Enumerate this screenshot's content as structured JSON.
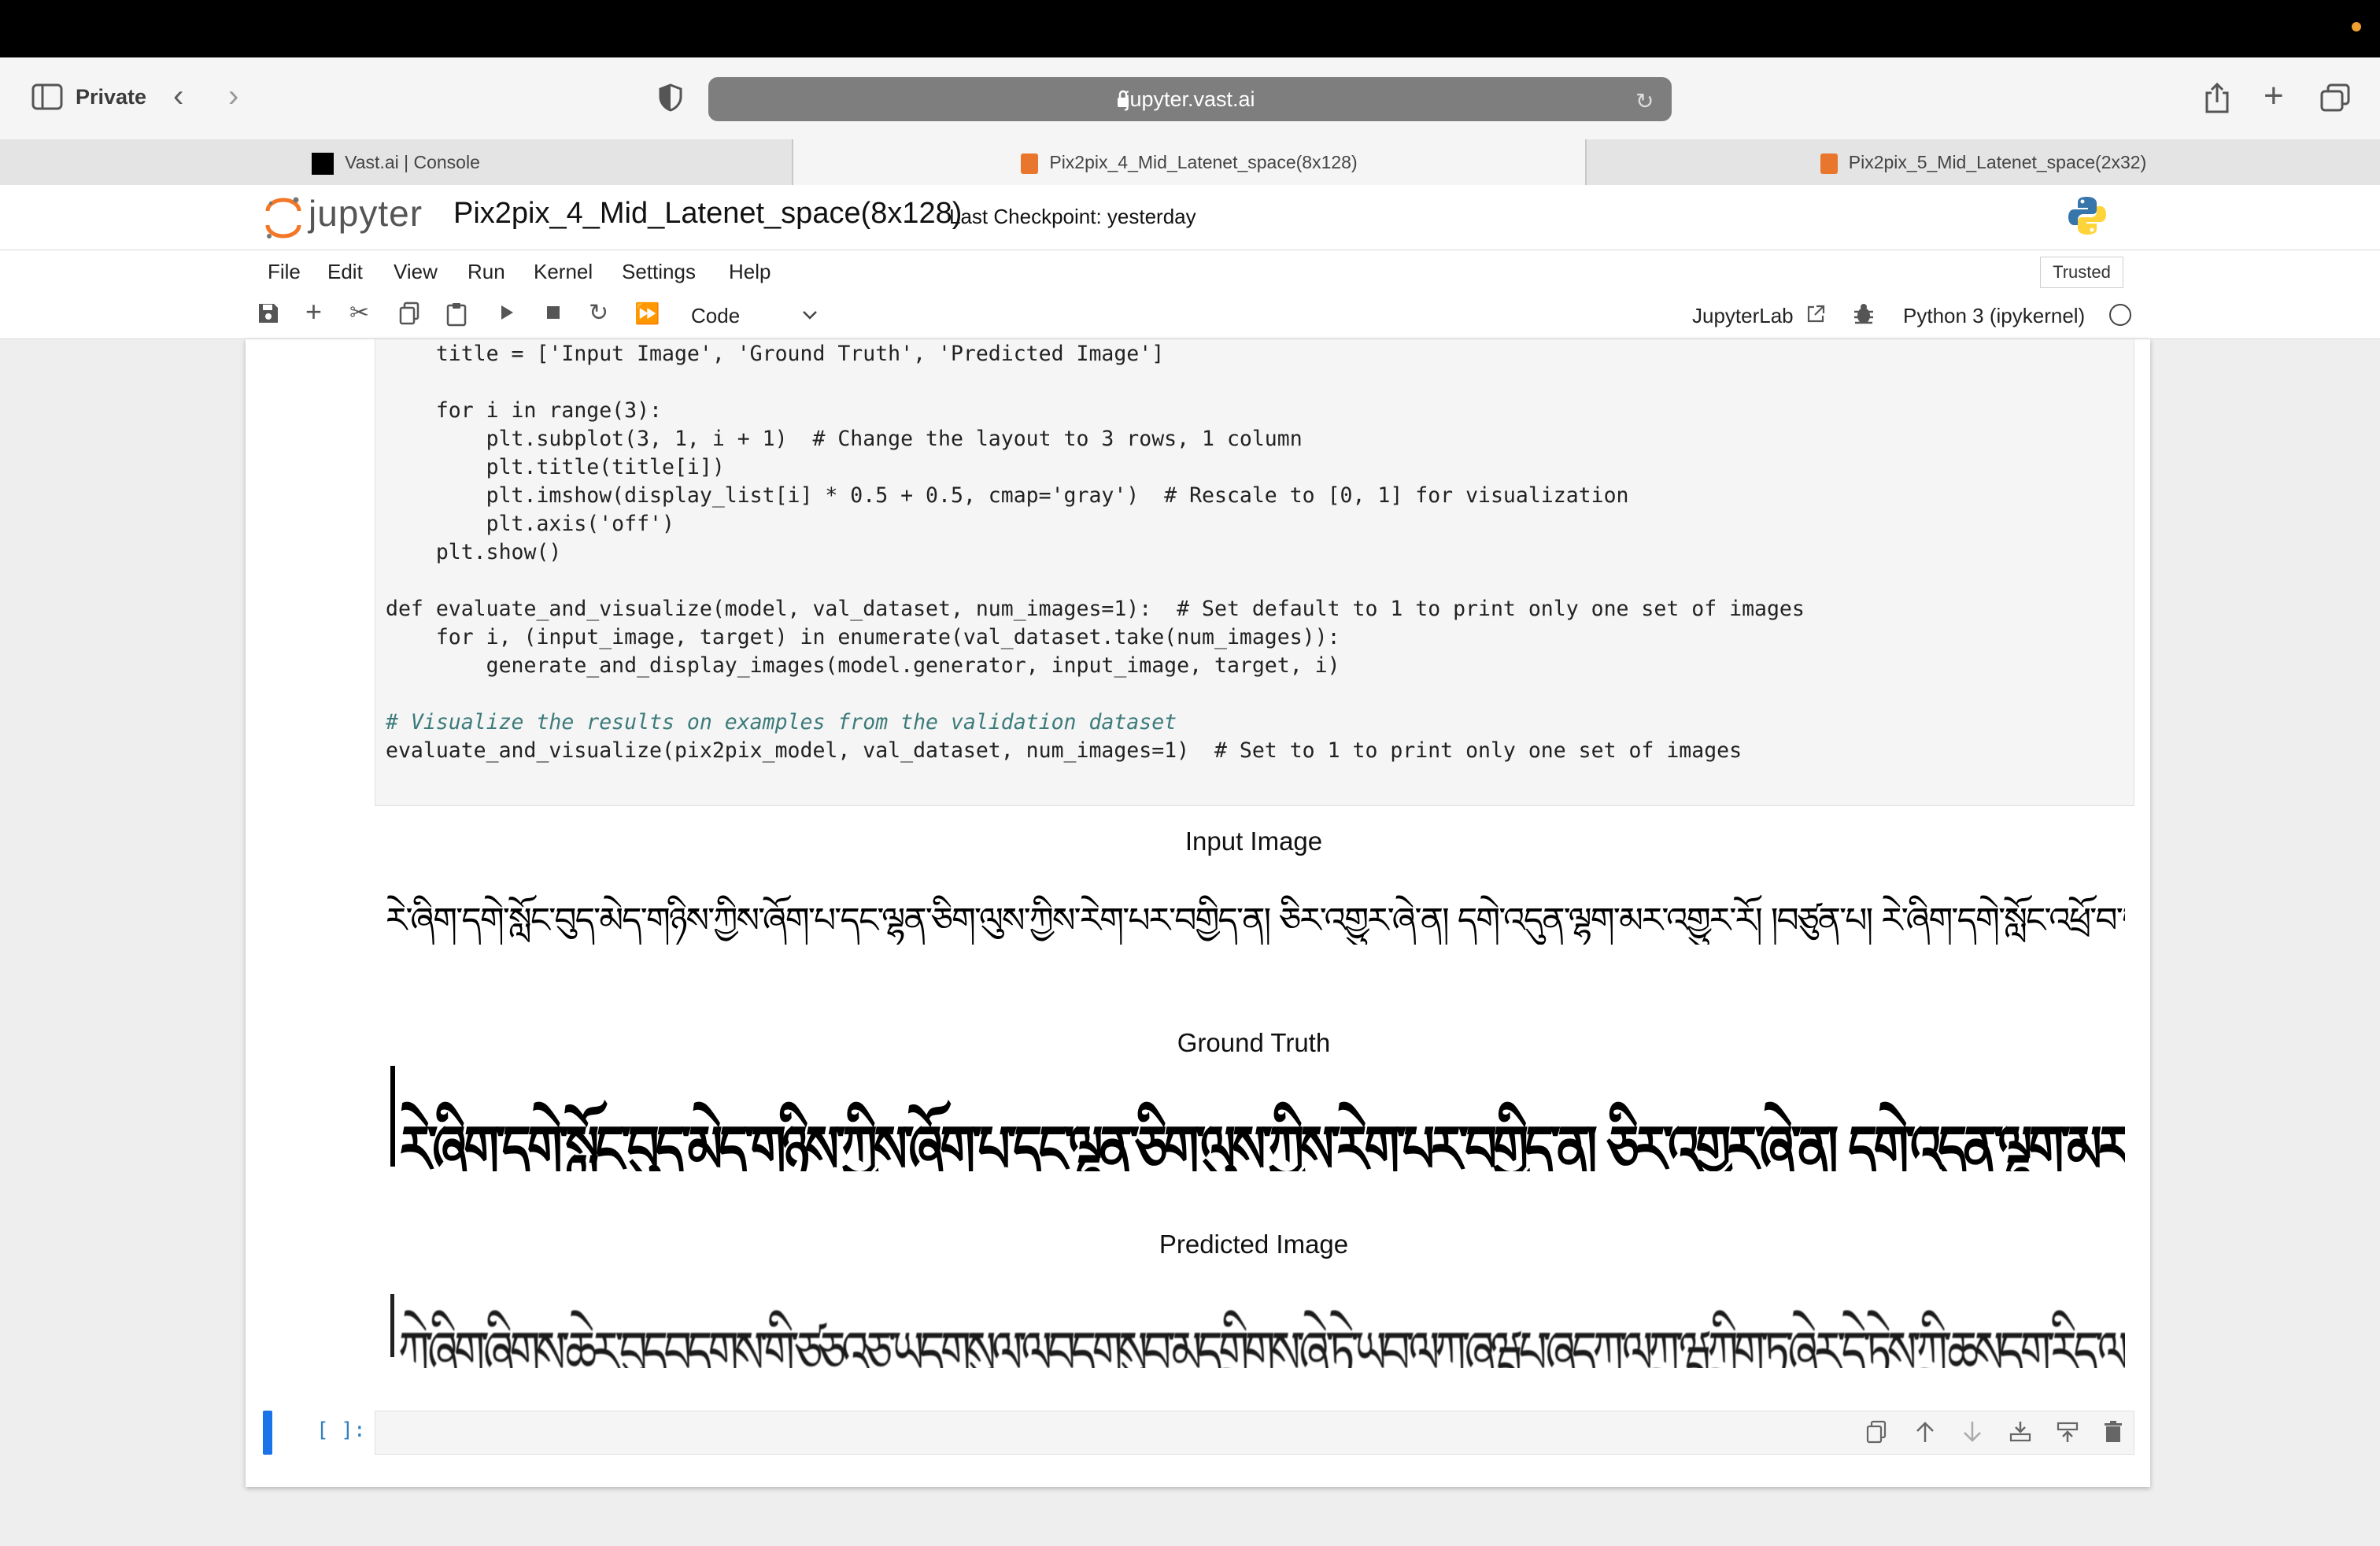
{
  "browser": {
    "private_label": "Private",
    "url": "jupyter.vast.ai",
    "tabs": [
      {
        "label": "Vast.ai | Console",
        "active": false
      },
      {
        "label": "Pix2pix_4_Mid_Latenet_space(8x128)",
        "active": true
      },
      {
        "label": "Pix2pix_5_Mid_Latenet_space(2x32)",
        "active": false
      }
    ]
  },
  "jupyter": {
    "logo_text": "jupyter",
    "notebook_title": "Pix2pix_4_Mid_Latenet_space(8x128)",
    "checkpoint": "Last Checkpoint: yesterday",
    "menu": [
      "File",
      "Edit",
      "View",
      "Run",
      "Kernel",
      "Settings",
      "Help"
    ],
    "trusted": "Trusted",
    "cell_type": "Code",
    "jupyterlab_link": "JupyterLab",
    "kernel": "Python 3 (ipykernel)"
  },
  "code_lines": [
    "    title = ['Input Image', 'Ground Truth', 'Predicted Image']",
    "",
    "    for i in range(3):",
    "        plt.subplot(3, 1, i + 1)  # Change the layout to 3 rows, 1 column",
    "        plt.title(title[i])",
    "        plt.imshow(display_list[i] * 0.5 + 0.5, cmap='gray')  # Rescale to [0, 1] for visualization",
    "        plt.axis('off')",
    "    plt.show()",
    "",
    "def evaluate_and_visualize(model, val_dataset, num_images=1):  # Set default to 1 to print only one set of images",
    "    for i, (input_image, target) in enumerate(val_dataset.take(num_images)):",
    "        generate_and_display_images(model.generator, input_image, target, i)",
    "",
    "# Visualize the results on examples from the validation dataset",
    "evaluate_and_visualize(pix2pix_model, val_dataset, num_images=1)  # Set to 1 to print only one set of images"
  ],
  "output": {
    "titles": [
      "Input Image",
      "Ground Truth",
      "Predicted Image"
    ],
    "input_text": "རེ་ཞིག་དགེ་སློང་བུད་མེད་གཉིས་ཀྱིས་ཞོག་པ་དང་ལྷན་ཅིག་ལུས་ཀྱིས་རེག་པར་བགྱིད་ན། ཅིར་འགྱུར་ཞེ་ན། དགེ་འདུན་ལྷག་མར་འགྱུར་རོ། །བཙུན་པ། རེ་ཞིག་དགེ་སློང་འཕྲོ་བ་གཞན་པའི་",
    "ground_truth_text": "རེ་ཞིག་དགེ་སློང་བུད་མེད་གཉིས་ཀྱིས་ཞོག་པ་དང་ལྷན་ཅིག་ལུས་ཀྱིས་རེག་པར་བགྱིད་ན། ཅིར་འགྱུར་ཞེ་ན། དགེ་འདུན་ལྷག་མར་འགྱུར་རོ། །བཙུན་པ། རེ་ཞིག་དགེ་སློང་འཕྲོ་བ་གཞན་པའི་",
    "predicted_text": "ཀེ་ཞིག་ཞིགས་ཆེར་བུདབདགས་གི་ཙཅའཅ་ཡདགསུལ་ལབདགསུབ་མདགྲིགས་ཞེ་ཏེ་ཡབ་ལཀ་ཞཝཔ་ཞདཀ་ལཀྲ་ཝཀྲིག་ཏུ་ཞེར་དེ་ཏེས་ཀྲི་ཆསདག་རིད་ལགཀ་ཞུན།"
  },
  "empty_cell_prompt": "[ ]:",
  "colors": {
    "active_cell": "#1a73e8",
    "url_bar": "#7e7e7e",
    "trusted_border": "#cfcfcf"
  }
}
